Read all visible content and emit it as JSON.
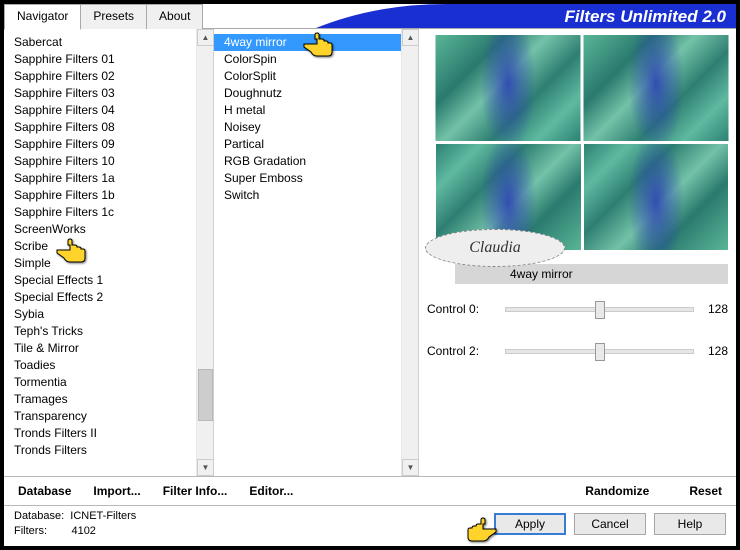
{
  "header": {
    "title": "Filters Unlimited 2.0",
    "tabs": [
      "Navigator",
      "Presets",
      "About"
    ],
    "active_tab": 0
  },
  "col1": {
    "items": [
      "Sabercat",
      "Sapphire Filters 01",
      "Sapphire Filters 02",
      "Sapphire Filters 03",
      "Sapphire Filters 04",
      "Sapphire Filters 08",
      "Sapphire Filters 09",
      "Sapphire Filters 10",
      "Sapphire Filters 1a",
      "Sapphire Filters 1b",
      "Sapphire Filters 1c",
      "ScreenWorks",
      "Scribe",
      "Simple",
      "Special Effects 1",
      "Special Effects 2",
      "Sybia",
      "Teph's Tricks",
      "Tile & Mirror",
      "Toadies",
      "Tormentia",
      "Tramages",
      "Transparency",
      "Tronds Filters II",
      "Tronds Filters"
    ],
    "selected": -1
  },
  "col2": {
    "items": [
      "4way mirror",
      "ColorSpin",
      "ColorSplit",
      "Doughnutz",
      "H metal",
      "Noisey",
      "Partical",
      "RGB Gradation",
      "Super Emboss",
      "Switch"
    ],
    "selected": 0
  },
  "preview": {
    "selected_filter": "4way mirror",
    "controls": [
      {
        "label": "Control 0:",
        "value": "128"
      },
      {
        "label": "Control 2:",
        "value": "128"
      }
    ],
    "badge": "Claudia"
  },
  "toolbar": [
    "Database",
    "Import...",
    "Filter Info...",
    "Editor..."
  ],
  "toolbar_right": [
    "Randomize",
    "Reset"
  ],
  "status": {
    "database_label": "Database:",
    "database_value": "ICNET-Filters",
    "filters_label": "Filters:",
    "filters_value": "4102"
  },
  "buttons": {
    "apply": "Apply",
    "cancel": "Cancel",
    "help": "Help"
  }
}
